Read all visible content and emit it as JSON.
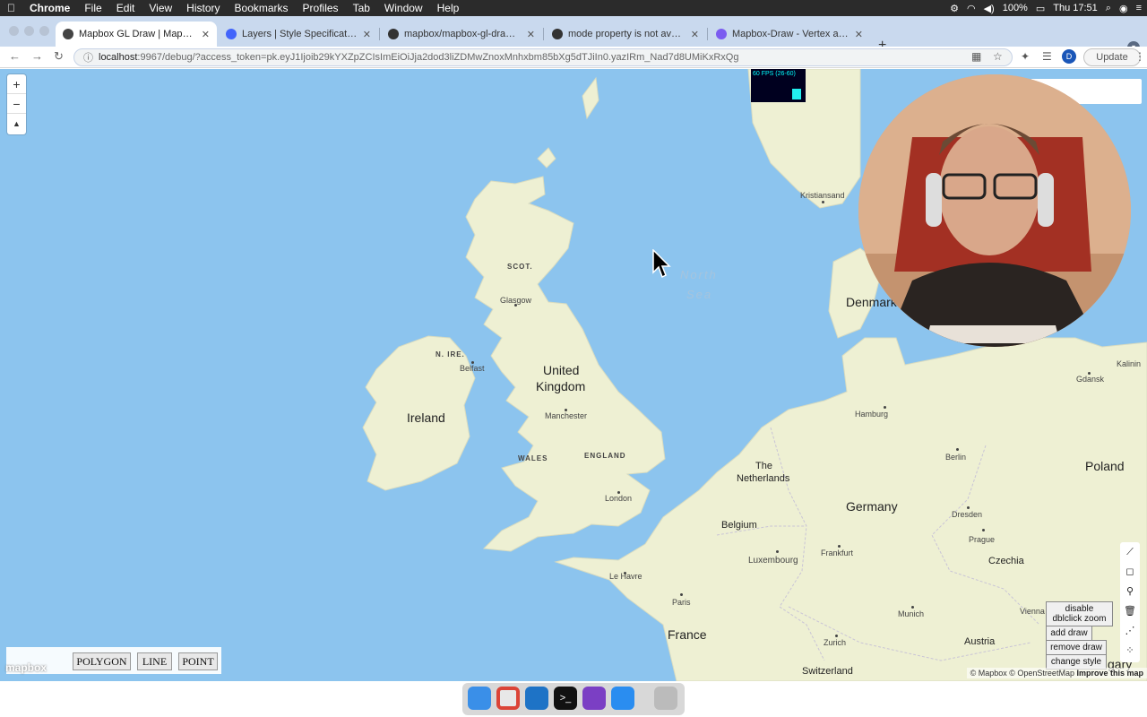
{
  "menubar": {
    "app_name": "Chrome",
    "items": [
      "File",
      "Edit",
      "View",
      "History",
      "Bookmarks",
      "Profiles",
      "Tab",
      "Window",
      "Help"
    ],
    "battery": "100%",
    "clock": "Thu 17:51"
  },
  "tabs": [
    {
      "title": "Mapbox GL Draw | Mapbox",
      "active": true,
      "icon": "globe-icon"
    },
    {
      "title": "Layers | Style Specification | M",
      "active": false,
      "icon": "mapbox-icon"
    },
    {
      "title": "mapbox/mapbox-gl-draw: Draw",
      "active": false,
      "icon": "github-icon"
    },
    {
      "title": "mode property is not available",
      "active": false,
      "icon": "github-icon"
    },
    {
      "title": "Mapbox-Draw - Vertex and Mid",
      "active": false,
      "icon": "react-icon"
    }
  ],
  "toolbar": {
    "url_host": "localhost",
    "url_path": ":9967/debug/?access_token=pk.eyJ1Ijoib29kYXZpZCIsImEiOiJja2dod3liZDMwZnoxMnhxbm85bXg5dTJiIn0.yazIRm_Nad7d8UMiKxRxQg",
    "profile_initial": "D",
    "update_label": "Update"
  },
  "map": {
    "zoom_in": "+",
    "zoom_out": "−",
    "compass": "▲",
    "fps_label": "60 FPS (26-60)",
    "labels": {
      "scot": "SCOT.",
      "glasgow": "Glasgow",
      "n_ire": "N. IRE.",
      "belfast": "Belfast",
      "ireland": "Ireland",
      "uk_1": "United",
      "uk_2": "Kingdom",
      "manchester": "Manchester",
      "wales": "WALES",
      "england": "ENGLAND",
      "london": "London",
      "north_sea_1": "North",
      "north_sea_2": "Sea",
      "kristiansand": "Kristiansand",
      "denmark": "Denmark",
      "hamburg": "Hamburg",
      "gdansk": "Gdansk",
      "kaliningrad": "Kalinin",
      "berlin": "Berlin",
      "poland": "Poland",
      "netherlands_1": "The",
      "netherlands_2": "Netherlands",
      "belgium": "Belgium",
      "germany": "Germany",
      "dresden": "Dresden",
      "prague": "Prague",
      "czechia": "Czechia",
      "luxembourg": "Luxembourg",
      "frankfurt": "Frankfurt",
      "le_havre": "Le Havre",
      "paris": "Paris",
      "france": "France",
      "munich": "Munich",
      "vienna": "Vienna",
      "austria": "Austria",
      "zurich": "Zurich",
      "switzerland": "Switzerland",
      "hungary": "gary"
    },
    "debug_buttons": {
      "disable_zoom_1": "disable",
      "disable_zoom_2": "dblclick zoom",
      "add_draw": "add draw",
      "remove_draw": "remove draw",
      "change_style": "change style"
    },
    "shape_buttons": {
      "polygon": "POLYGON",
      "line": "LINE",
      "point": "POINT"
    },
    "logo": "mapbox",
    "attribution": {
      "mapbox": "© Mapbox",
      "osm": "© OpenStreetMap",
      "improve": "Improve this map"
    }
  },
  "dock": [
    "Finder",
    "Chrome",
    "VS Code",
    "Terminal",
    "GitHub Desktop",
    "Xcode",
    "Trash"
  ],
  "colors": {
    "water": "#8cc4ee",
    "land": "#eef0d3",
    "tabbar": "#c9d9ee"
  }
}
